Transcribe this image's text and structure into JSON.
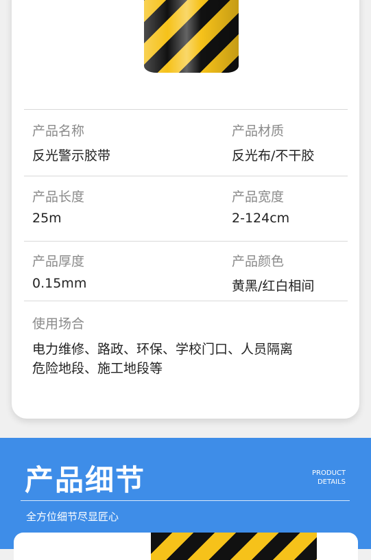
{
  "specs": [
    {
      "label": "产品名称",
      "value": "反光警示胶带"
    },
    {
      "label": "产品材质",
      "value": "反光布/不干胶"
    },
    {
      "label": "产品长度",
      "value": "25m"
    },
    {
      "label": "产品宽度",
      "value": "2-124cm"
    },
    {
      "label": "产品厚度",
      "value": "0.15mm"
    },
    {
      "label": "产品颜色",
      "value": "黄黑/红白相间"
    }
  ],
  "usage": {
    "label": "使用场合",
    "lines": [
      "电力维修、路政、环保、学校门口、人员隔离",
      "危险地段、施工地段等"
    ]
  },
  "details_section": {
    "title": "产品细节",
    "en_line1": "PRODUCT",
    "en_line2": "DETAILS",
    "subtitle": "全方位细节尽显匠心"
  },
  "colors": {
    "blue": "#3e8de8",
    "tape_yellow": "#f6c21a",
    "tape_black": "#111111"
  }
}
